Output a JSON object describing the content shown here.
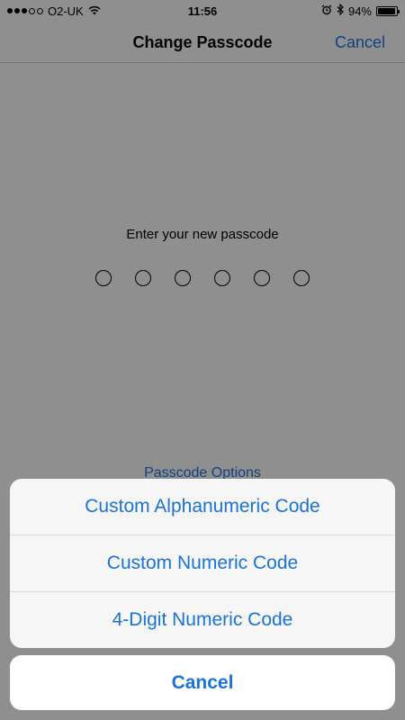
{
  "status_bar": {
    "carrier": "O2-UK",
    "time": "11:56",
    "battery_text": "94%",
    "battery_level": 0.94,
    "signal_bars_filled": 3,
    "signal_bars_total": 5
  },
  "nav": {
    "title": "Change Passcode",
    "cancel_label": "Cancel"
  },
  "passcode": {
    "prompt": "Enter your new passcode",
    "digit_count": 6,
    "options_label": "Passcode Options"
  },
  "action_sheet": {
    "items": [
      {
        "label": "Custom Alphanumeric Code"
      },
      {
        "label": "Custom Numeric Code"
      },
      {
        "label": "4-Digit Numeric Code"
      }
    ],
    "cancel_label": "Cancel"
  },
  "colors": {
    "accent": "#1a73d9",
    "dim_overlay": "#000000"
  }
}
